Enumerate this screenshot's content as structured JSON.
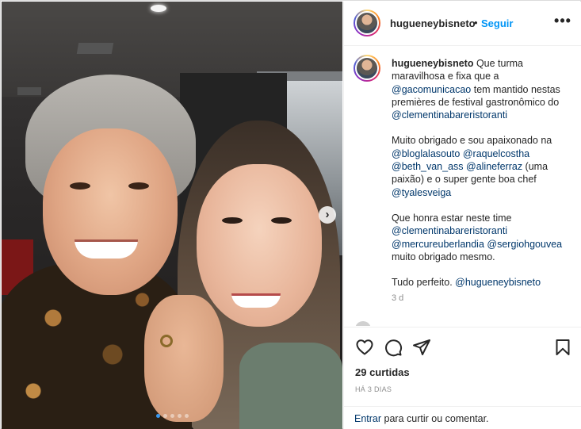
{
  "post": {
    "username": "hugueneybisneto",
    "separator": "•",
    "follow_label": "Seguir",
    "more_label": "•••"
  },
  "caption": {
    "username": "hugueneybisneto",
    "p1_a": " Que turma maravilhosa e fixa que a ",
    "p1_tag1": "@gacomunicacao",
    "p1_b": " tem mantido nestas premières de festival gastronômico do ",
    "p1_tag2": "@clementinabareristoranti",
    "p2_a": "Muito obrigado e sou apaixonado na ",
    "p2_tag1": "@bloglalasouto",
    "p2_tag2": "@raquelcostha",
    "p2_tag3": "@beth_van_ass",
    "p2_tag4": "@alineferraz",
    "p2_b": " (uma paixão) e o super gente boa chef ",
    "p2_tag5": "@tyalesveiga",
    "p3_a": "Que honra estar neste time ",
    "p3_tag1": "@clementinabareristoranti",
    "p3_tag2": "@mercureuberlandia",
    "p3_tag3": "@sergiohgouvea",
    "p3_b": " muito obrigado mesmo.",
    "p4_a": "Tudo perfeito. ",
    "p4_tag1": "@hugueneybisneto",
    "time_ago": "3 d"
  },
  "stats": {
    "likes": "29 curtidas",
    "date": "HÁ 3 DIAS"
  },
  "login": {
    "link": "Entrar",
    "rest": " para curtir ou comentar."
  },
  "carousel": {
    "count": 5,
    "active_index": 0
  },
  "colors": {
    "link": "#0095f6",
    "mention": "#00376b",
    "muted": "#8e8e8e",
    "active_dot": "#3897f0"
  },
  "icons": [
    "heart-icon",
    "comment-icon",
    "share-icon",
    "bookmark-icon",
    "chevron-right-icon",
    "more-icon"
  ]
}
